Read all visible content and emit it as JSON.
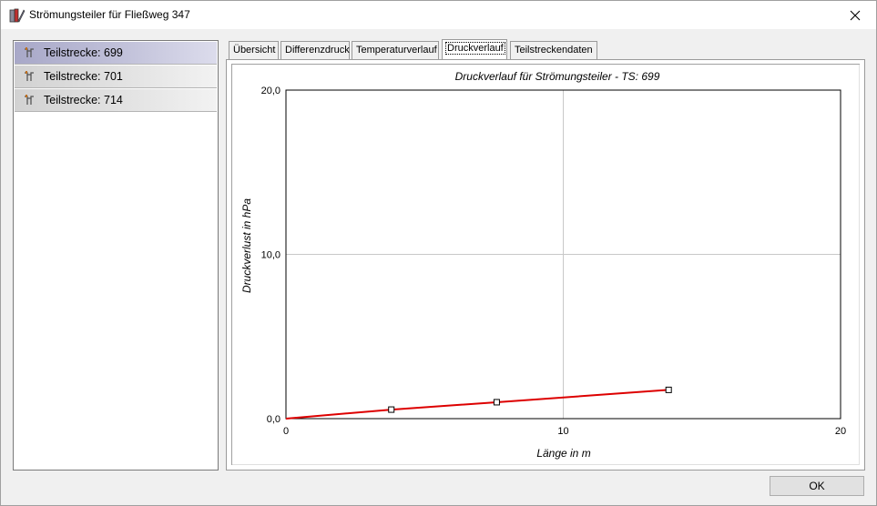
{
  "window": {
    "title": "Strömungsteiler für Fließweg 347"
  },
  "list": {
    "items": [
      {
        "label": "Teilstrecke: 699",
        "selected": true,
        "icon": "pipe-segment-icon"
      },
      {
        "label": "Teilstrecke: 701",
        "selected": false,
        "icon": "pipe-segment-icon"
      },
      {
        "label": "Teilstrecke: 714",
        "selected": false,
        "icon": "pipe-segment-icon"
      }
    ]
  },
  "tabs": [
    {
      "label": "Übersicht",
      "active": false
    },
    {
      "label": "Differenzdruck",
      "active": false
    },
    {
      "label": "Temperaturverlauf",
      "active": false
    },
    {
      "label": "Druckverlauf",
      "active": true
    },
    {
      "label": "Teilstreckendaten",
      "active": false
    }
  ],
  "buttons": {
    "ok_label": "OK"
  },
  "colors": {
    "series": "#dd0000",
    "selected_item": "#b8b8d4"
  },
  "chart_data": {
    "type": "line",
    "title": "Druckverlauf für Strömungsteiler - TS: 699",
    "xlabel": "Länge in m",
    "ylabel": "Druckverlust in hPa",
    "xlim": [
      0,
      20
    ],
    "ylim": [
      0,
      20
    ],
    "xticks": [
      0,
      10,
      20
    ],
    "yticks": [
      0,
      10,
      20
    ],
    "xtick_labels": [
      "0",
      "10",
      "20"
    ],
    "ytick_labels": [
      "0,0",
      "10,0",
      "20,0"
    ],
    "grid": true,
    "series": [
      {
        "x": [
          0,
          3.8,
          7.6,
          13.8
        ],
        "y": [
          0,
          0.55,
          1.0,
          1.75
        ],
        "markers": [
          false,
          true,
          true,
          true
        ]
      }
    ]
  }
}
